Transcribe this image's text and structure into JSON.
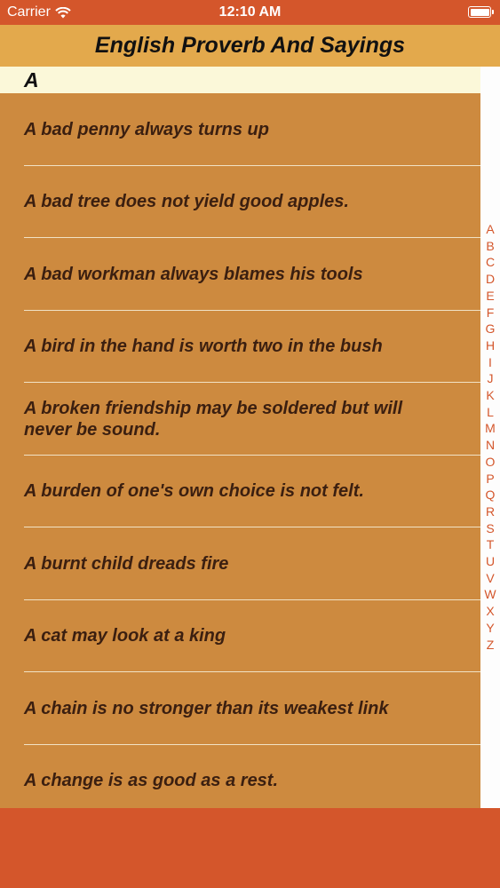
{
  "status": {
    "carrier": "Carrier",
    "time": "12:10 AM",
    "wifi_icon": "wifi-icon",
    "battery_icon": "battery-icon"
  },
  "nav": {
    "title": "English Proverb And Sayings"
  },
  "section": {
    "header": "A"
  },
  "proverbs": [
    "A bad penny always turns up",
    "A bad tree does not yield good apples.",
    "A bad workman always blames his tools",
    "A bird in the hand is worth two in the bush",
    "A broken friendship may be soldered but will never be sound.",
    "A burden of one's own choice is not felt.",
    "A burnt child dreads fire",
    "A cat may look at a king",
    "A chain is no stronger than its weakest link",
    "A change is as good as a rest."
  ],
  "index_letters": [
    "A",
    "B",
    "C",
    "D",
    "E",
    "F",
    "G",
    "H",
    "I",
    "J",
    "K",
    "L",
    "M",
    "N",
    "O",
    "P",
    "Q",
    "R",
    "S",
    "T",
    "U",
    "V",
    "W",
    "X",
    "Y",
    "Z"
  ],
  "colors": {
    "status_bar": "#d4562b",
    "nav_bar": "#e3a94c",
    "section_header": "#fbf8d9",
    "list_background": "#cd8a3f",
    "row_text": "#3b1f10",
    "index_letter": "#d4562b"
  }
}
